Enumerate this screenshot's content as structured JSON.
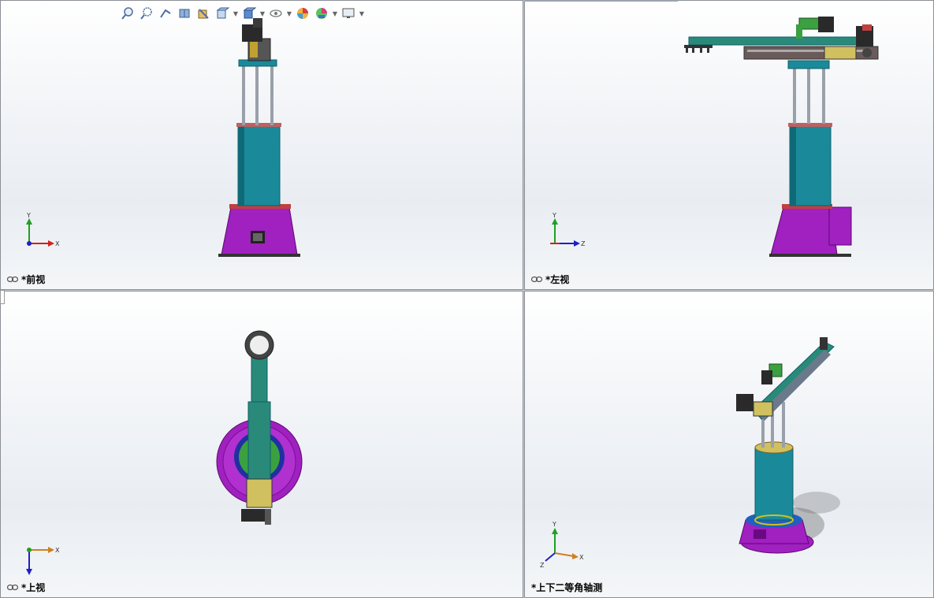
{
  "toolbar": {
    "buttons": [
      {
        "icon": "zoom-to-fit-icon",
        "caret": false
      },
      {
        "icon": "zoom-to-area-icon",
        "caret": false
      },
      {
        "icon": "previous-view-icon",
        "caret": false
      },
      {
        "icon": "section-view-icon",
        "caret": false
      },
      {
        "icon": "dynamic-annotation-icon",
        "caret": false
      },
      {
        "icon": "view-orientation-icon",
        "caret": true
      },
      {
        "icon": "display-style-icon",
        "caret": true
      },
      {
        "icon": "hide-show-items-icon",
        "caret": true
      },
      {
        "icon": "edit-appearance-icon",
        "caret": false
      },
      {
        "icon": "apply-scene-icon",
        "caret": true
      },
      {
        "icon": "view-settings-icon",
        "caret": true
      }
    ]
  },
  "views": {
    "front": {
      "label": "*前视",
      "axes": {
        "up": "Y",
        "right": "X"
      }
    },
    "left": {
      "label": "*左视",
      "axes": {
        "up": "Y",
        "right": "Z"
      }
    },
    "top": {
      "label": "*上视",
      "axes": {
        "down": "Z",
        "right": "X"
      }
    },
    "iso": {
      "label": "*上下二等角轴测",
      "axes": {
        "up": "Y",
        "right": "X",
        "left": "Z"
      }
    }
  },
  "colors": {
    "base": "#a020c0",
    "base_dark": "#7a1090",
    "column": "#1a8a9a",
    "column_dark": "#0f5f6a",
    "arm": "#2a8a7a",
    "rod": "#9aa0aa",
    "motor": "#2a2a2a",
    "green_part": "#3aa040",
    "axis_x": "#d02020",
    "axis_y": "#20a020",
    "axis_z": "#2020c0"
  }
}
